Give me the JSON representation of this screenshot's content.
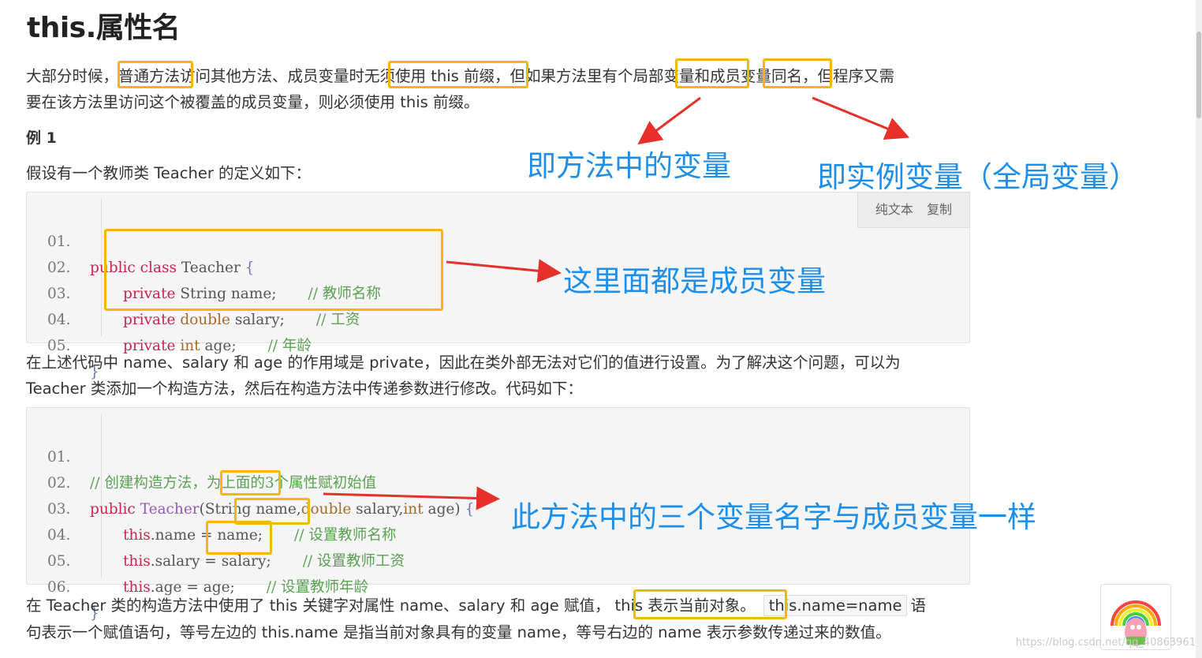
{
  "page": {
    "title": "this.属性名",
    "para1_line1": "大部分时候，普通方法访问其他方法、成员变量时无须使用 this 前缀，但如果方法里有个局部变量和成员变量同名，但程序又需",
    "para1_line2": "要在该方法里访问这个被覆盖的成员变量，则必须使用 this 前缀。",
    "example_heading": "例 1",
    "para2": "假设有一个教师类 Teacher 的定义如下：",
    "para3_line1": "在上述代码中 name、salary 和 age 的作用域是 private，因此在类外部无法对它们的值进行设置。为了解决这个问题，可以为",
    "para3_line2": "Teacher 类添加一个构造方法，然后在构造方法中传递参数进行修改。代码如下：",
    "para4_line1_a": "在 Teacher 类的构造方法中使用了 this 关键字对属性 name、salary 和 age 赋值，",
    "para4_line1_hl": "this 表示当前对象。",
    "para4_line1_code": "this.name=name",
    "para4_line1_b": "语",
    "para4_line2": "句表示一个赋值语句，等号左边的 this.name 是指当前对象具有的变量 name，等号右边的 name 表示参数传递过来的数值。"
  },
  "code_toolbar": {
    "plain_text": "纯文本",
    "copy": "复制"
  },
  "code1": {
    "line_numbers": [
      "01.",
      "02.",
      "03.",
      "04.",
      "05."
    ],
    "l1_kw": "public class",
    "l1_name": " Teacher ",
    "l1_brace": "{",
    "l2_kw": "private",
    "l2_type": " String",
    "l2_rest": " name;",
    "l2_cm": "// 教师名称",
    "l3_kw": "private",
    "l3_type": " double",
    "l3_rest": " salary;",
    "l3_cm": "// 工资",
    "l4_kw": "private",
    "l4_type": " int",
    "l4_rest": " age;",
    "l4_cm": "// 年龄",
    "l5_brace": "}"
  },
  "code2": {
    "line_numbers": [
      "01.",
      "02.",
      "03.",
      "04.",
      "05.",
      "06."
    ],
    "l1_cm": "// 创建构造方法，为上面的3个属性赋初始值",
    "l2_kw": "public",
    "l2_ctor": " Teacher",
    "l2_p1": "(String name,",
    "l2_t2": "double",
    "l2_p2": " salary,",
    "l2_t3": "int",
    "l2_p3": " age)",
    "l2_brace": " {",
    "l3_this": "this",
    "l3_rest": ".name = ",
    "l3_val": "name;",
    "l3_cm": "// 设置教师名称",
    "l4_this": "this",
    "l4_rest": ".salary = ",
    "l4_val": "salary;",
    "l4_cm": "// 设置教师工资",
    "l5_this": "this",
    "l5_rest": ".age = ",
    "l5_val": "age;",
    "l5_cm": "// 设置教师年龄",
    "l6_brace": "}"
  },
  "annotations": {
    "local_var": "即方法中的变量",
    "instance_var": "即实例变量（全局变量）",
    "members": "这里面都是成员变量",
    "params": "此方法中的三个变量名字与成员变量一样"
  },
  "watermark": "https://blog.csdn.net/qq_40863961",
  "colors": {
    "highlight": "#f5b800",
    "annotation": "#1e8fe8",
    "arrow": "#e8302a"
  }
}
